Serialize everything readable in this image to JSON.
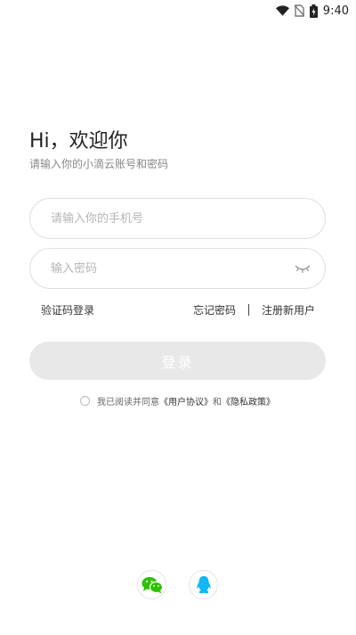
{
  "status_bar": {
    "time": "9:40",
    "icons": [
      "wifi-icon",
      "no-sim-icon",
      "battery-icon"
    ]
  },
  "greeting": {
    "title": "Hi，欢迎你",
    "subtitle": "请输入你的小滴云账号和密码"
  },
  "form": {
    "phone_placeholder": "请输入你的手机号",
    "phone_value": "",
    "password_placeholder": "输入密码",
    "password_value": "",
    "password_toggle_icon": "eye-closed-icon"
  },
  "links": {
    "sms_login": "验证码登录",
    "forgot_password": "忘记密码",
    "register": "注册新用户"
  },
  "login_button": {
    "label": "登录",
    "state": "disabled"
  },
  "agreement": {
    "prefix": "我已阅读并同意",
    "user_agreement": "《用户协议》",
    "and": "和",
    "privacy_policy": "《隐私政策》",
    "checked": false
  },
  "social_login": {
    "wechat_icon": "wechat-icon",
    "qq_icon": "qq-icon"
  },
  "colors": {
    "wechat": "#2dc100",
    "qq": "#12b7f5",
    "button_disabled": "#e8e8e8",
    "field_border": "#e0e0e0"
  }
}
